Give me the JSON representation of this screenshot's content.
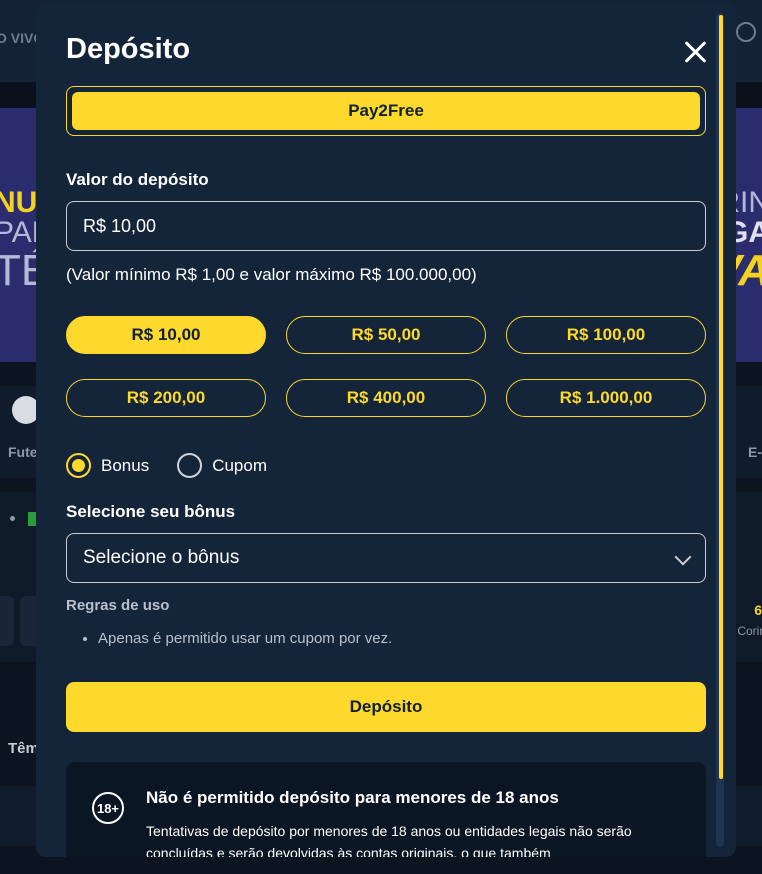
{
  "background": {
    "topbar_text": "O VIVO",
    "banner_left": [
      "NUS",
      "PAR",
      "TÉ"
    ],
    "banner_right": [
      "RIN",
      "GA",
      "VA"
    ],
    "sport_left": "Fute",
    "sport_right": "E-",
    "number_right": "6",
    "team_right": "Corin",
    "section_left": "Têm"
  },
  "modal": {
    "title": "Depósito",
    "method_label": "Pay2Free",
    "amount_label": "Valor do depósito",
    "amount_value": "R$ 10,00",
    "limits_note": "(Valor mínimo R$ 1,00 e valor máximo R$ 100.000,00)",
    "quick_amounts": [
      "R$ 10,00",
      "R$ 50,00",
      "R$ 100,00",
      "R$ 200,00",
      "R$ 400,00",
      "R$ 1.000,00"
    ],
    "selected_amount_index": 0,
    "radio_options": [
      "Bonus",
      "Cupom"
    ],
    "selected_radio": "Bonus",
    "bonus_label": "Selecione seu bônus",
    "bonus_select_value": "Selecione o bônus",
    "rules_title": "Regras de uso",
    "rules": [
      "Apenas é permitido usar um cupom por vez."
    ],
    "deposit_button": "Depósito",
    "warning_badge": "18+",
    "warning_title": "Não é permitido depósito para menores de 18 anos",
    "warning_text": "Tentativas de depósito por menores de 18 anos ou entidades legais não serão concluídas e serão devolvidas às contas originais, o que também"
  },
  "colors": {
    "accent": "#fcd92b",
    "modal_bg": "#142439",
    "overlay_bg": "#0c1420"
  }
}
